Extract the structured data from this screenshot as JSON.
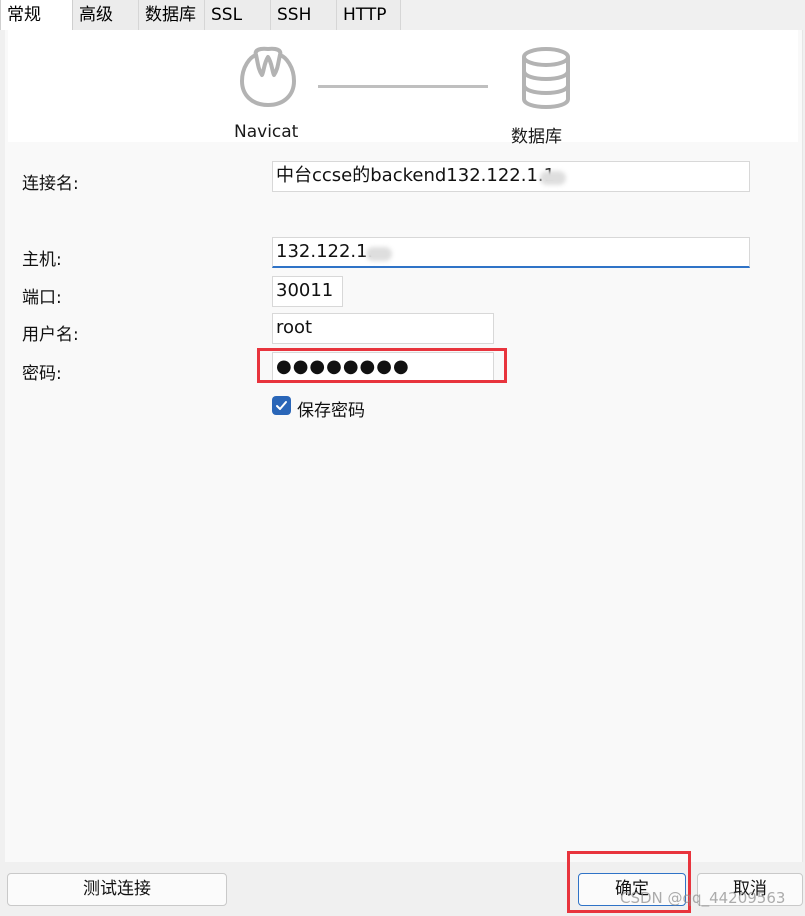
{
  "tabs": [
    {
      "label": "常规",
      "active": true
    },
    {
      "label": "高级",
      "active": false
    },
    {
      "label": "数据库",
      "active": false
    },
    {
      "label": "SSL",
      "active": false
    },
    {
      "label": "SSH",
      "active": false
    },
    {
      "label": "HTTP",
      "active": false
    }
  ],
  "diagram": {
    "left_caption": "Navicat",
    "right_caption": "数据库",
    "left_icon": "navicat-logo",
    "right_icon": "database-icon"
  },
  "form": {
    "connection_name": {
      "label": "连接名:",
      "value": "中台ccse的backend132.122.1.1"
    },
    "host": {
      "label": "主机:",
      "value": "132.122.1."
    },
    "port": {
      "label": "端口:",
      "value": "30011"
    },
    "username": {
      "label": "用户名:",
      "value": "root"
    },
    "password": {
      "label": "密码:",
      "value": "●●●●●●●●"
    },
    "save_password": {
      "label": "保存密码",
      "checked": true
    }
  },
  "buttons": {
    "test": "测试连接",
    "ok": "确定",
    "cancel": "取消"
  },
  "watermark": "CSDN @qq_44209563",
  "colors": {
    "accent": "#2f73c7",
    "highlight": "#e8343d",
    "checkbox": "#2a66b8"
  }
}
